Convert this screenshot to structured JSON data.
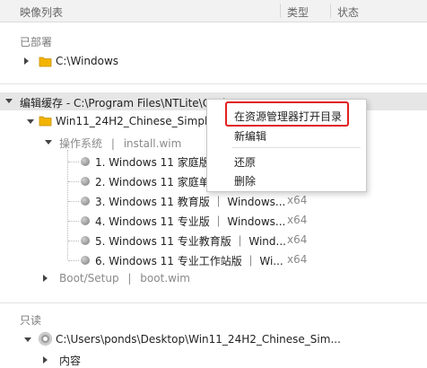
{
  "header": {
    "col_name": "映像列表",
    "col_type": "类型",
    "col_status": "状态"
  },
  "deployed": {
    "group_label": "已部署",
    "item": "C:\\Windows"
  },
  "cache": {
    "group_label": "编辑缓存 - C:\\Program Files\\NTLite\\Cache\\Images",
    "image": "Win11_24H2_Chinese_Simplified",
    "os": {
      "label": "操作系统",
      "sep": "|",
      "file": "install.wim"
    },
    "editions": [
      {
        "label": "1. Windows 11 家庭版",
        "type": ""
      },
      {
        "label": "2. Windows 11 家庭单",
        "type": ""
      },
      {
        "label": "3. Windows 11 教育版 ｜ Windows...",
        "type": "x64"
      },
      {
        "label": "4. Windows 11 专业版 ｜ Windows...",
        "type": "x64"
      },
      {
        "label": "5. Windows 11 专业教育版 ｜ Wind...",
        "type": "x64"
      },
      {
        "label": "6. Windows 11 专业工作站版 ｜ Wi...",
        "type": "x64"
      }
    ],
    "boot": {
      "label": "Boot/Setup",
      "sep": "|",
      "file": "boot.wim"
    }
  },
  "readonly": {
    "group_label": "只读",
    "item": "C:\\Users\\ponds\\Desktop\\Win11_24H2_Chinese_Sim...",
    "child": "内容"
  },
  "context_menu": {
    "open_in_explorer": "在资源管理器打开目录",
    "new_edit": "新编辑",
    "restore": "还原",
    "delete": "删除"
  },
  "colors": {
    "highlight_border": "#e02020",
    "folder": "#f2b400",
    "selection": "#e6e6e6"
  }
}
